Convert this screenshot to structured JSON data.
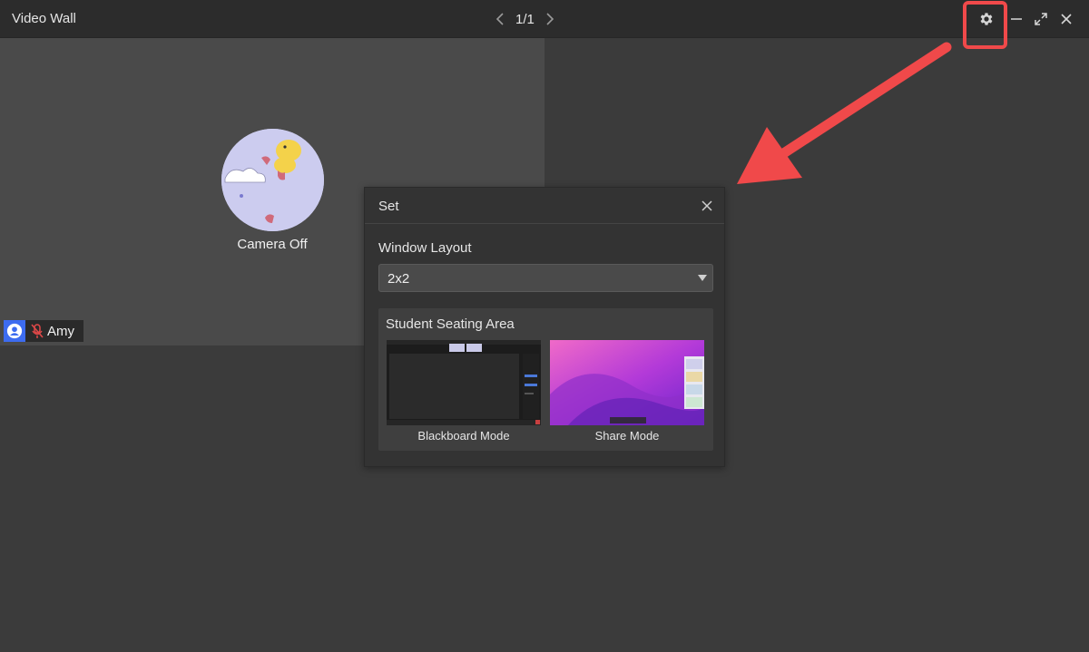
{
  "window": {
    "title": "Video Wall",
    "pager": "1/1"
  },
  "tile": {
    "camera_status": "Camera Off",
    "participant_name": "Amy"
  },
  "dialog": {
    "title": "Set",
    "window_layout_label": "Window Layout",
    "window_layout_value": "2x2",
    "seating_area_title": "Student Seating Area",
    "modes": [
      {
        "label": "Blackboard Mode"
      },
      {
        "label": "Share Mode"
      }
    ]
  },
  "colors": {
    "accent_red": "#f0494a",
    "user_badge_blue": "#3d6cf0"
  }
}
